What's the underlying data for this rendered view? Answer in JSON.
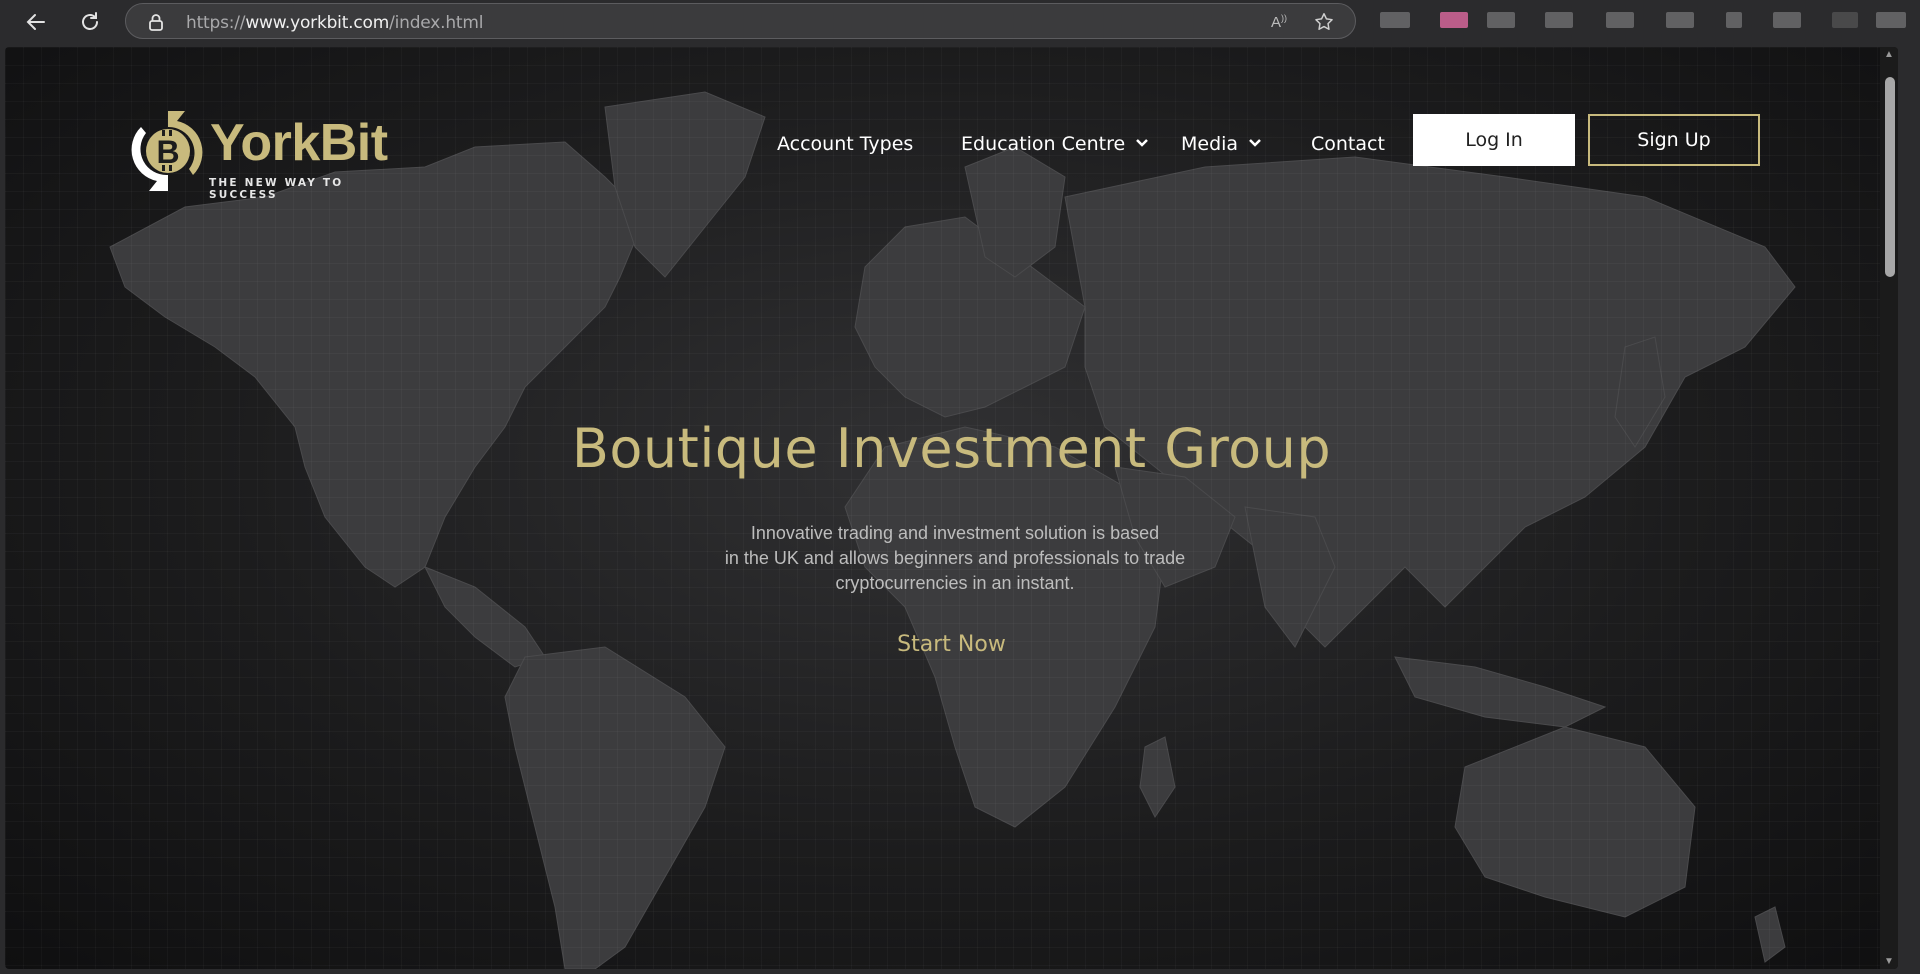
{
  "browser": {
    "url_prefix": "https://",
    "url_domain": "www.yorkbit.com",
    "url_path": "/index.html",
    "read_aloud_label": "A",
    "icons": [
      "back-icon",
      "refresh-icon",
      "lock-icon",
      "read-aloud-icon",
      "favorite-star-icon"
    ]
  },
  "site": {
    "logo": {
      "name": "YorkBit",
      "tagline": "THE NEW WAY TO SUCCESS"
    },
    "nav": {
      "account_types": "Account Types",
      "education_centre": "Education Centre",
      "media": "Media",
      "contact": "Contact",
      "login": "Log In",
      "signup": "Sign Up"
    },
    "hero": {
      "title": "Boutique Investment Group",
      "subtitle_lines": [
        "Innovative trading and investment solution is based",
        "in the UK and allows beginners and professionals to trade",
        "cryptocurrencies in an instant."
      ],
      "cta": "Start Now"
    }
  },
  "colors": {
    "gold": "#c8ba7d",
    "background": "#1c1c1d",
    "white": "#ffffff"
  }
}
